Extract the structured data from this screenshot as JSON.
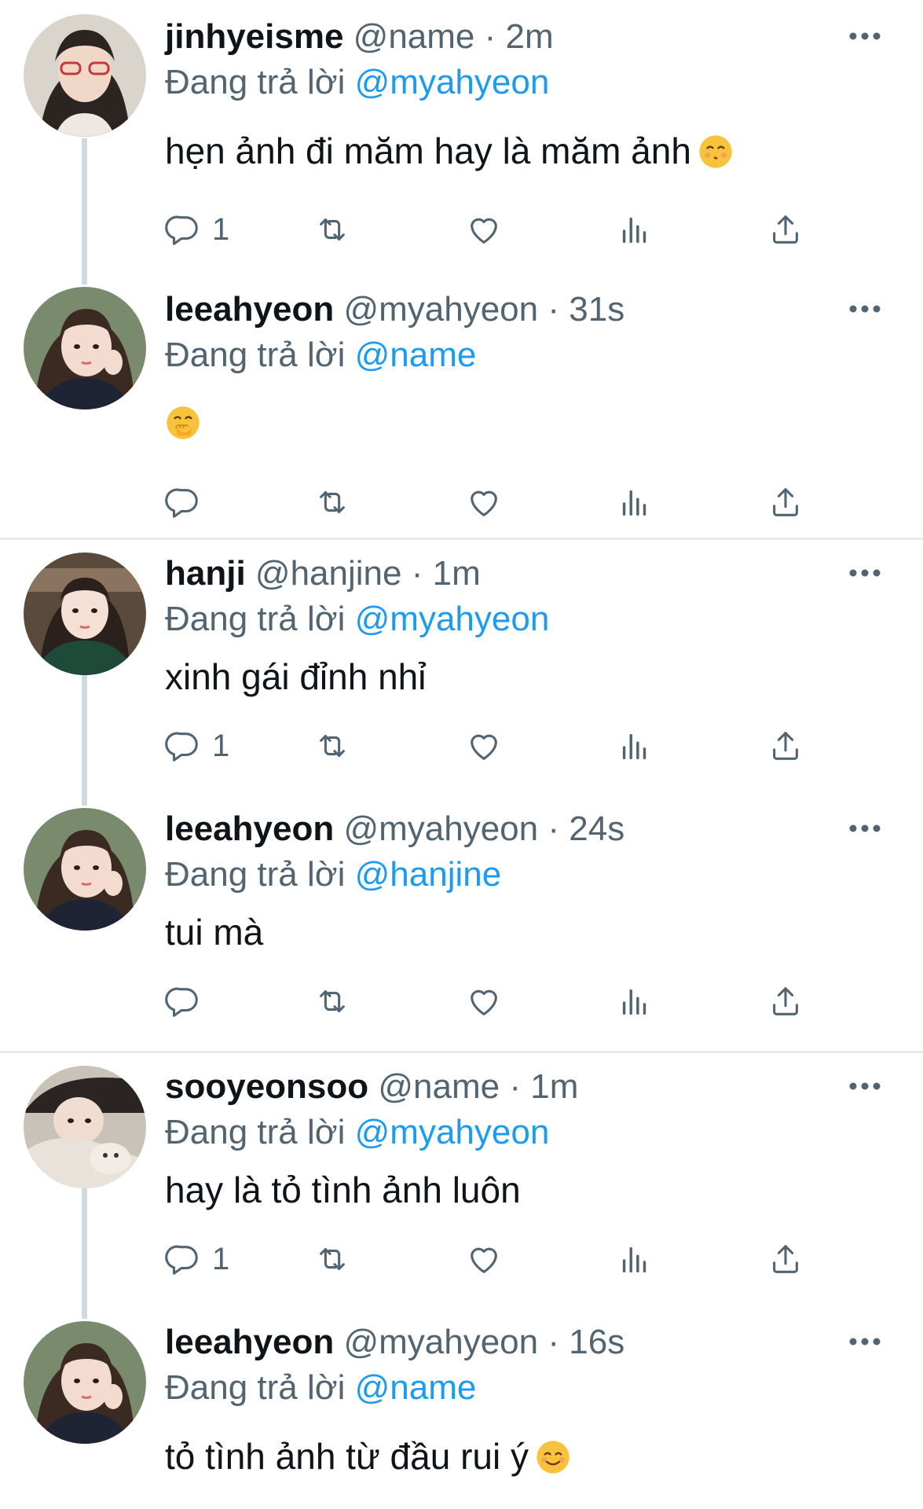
{
  "colors": {
    "text": "#0f1419",
    "muted": "#536471",
    "link": "#1d9bf0",
    "connector": "#cfd9de",
    "divider": "#e7e9ea"
  },
  "threads": [
    {
      "tweets": [
        {
          "name": "jinhyeisme",
          "handle": "@name",
          "dot": "·",
          "time": "2m",
          "replying_prefix": "Đang trả lời",
          "replying_to": "@myahyeon",
          "text": "hẹn ảnh đi măm hay là măm ảnh",
          "emoji": "kissing-face-icon",
          "reply_count": "1"
        },
        {
          "name": "leeahyeon",
          "handle": "@myahyeon",
          "dot": "·",
          "time": "31s",
          "replying_prefix": "Đang trả lời",
          "replying_to": "@name",
          "text": "",
          "emoji": "hand-over-mouth-icon",
          "reply_count": ""
        }
      ]
    },
    {
      "tweets": [
        {
          "name": "hanji",
          "handle": "@hanjine",
          "dot": "·",
          "time": "1m",
          "replying_prefix": "Đang trả lời",
          "replying_to": "@myahyeon",
          "text": "xinh gái đỉnh nhỉ",
          "emoji": "",
          "reply_count": "1"
        },
        {
          "name": "leeahyeon",
          "handle": "@myahyeon",
          "dot": "·",
          "time": "24s",
          "replying_prefix": "Đang trả lời",
          "replying_to": "@hanjine",
          "text": "tui mà",
          "emoji": "",
          "reply_count": ""
        }
      ]
    },
    {
      "tweets": [
        {
          "name": "sooyeonsoo",
          "handle": "@name",
          "dot": "·",
          "time": "1m",
          "replying_prefix": "Đang trả lời",
          "replying_to": "@myahyeon",
          "text": "hay là tỏ tình ảnh luôn",
          "emoji": "",
          "reply_count": "1"
        },
        {
          "name": "leeahyeon",
          "handle": "@myahyeon",
          "dot": "·",
          "time": "16s",
          "replying_prefix": "Đang trả lời",
          "replying_to": "@name",
          "text": "tỏ tình ảnh từ đầu rui ý",
          "emoji": "smiling-face-icon",
          "reply_count": ""
        }
      ]
    }
  ]
}
